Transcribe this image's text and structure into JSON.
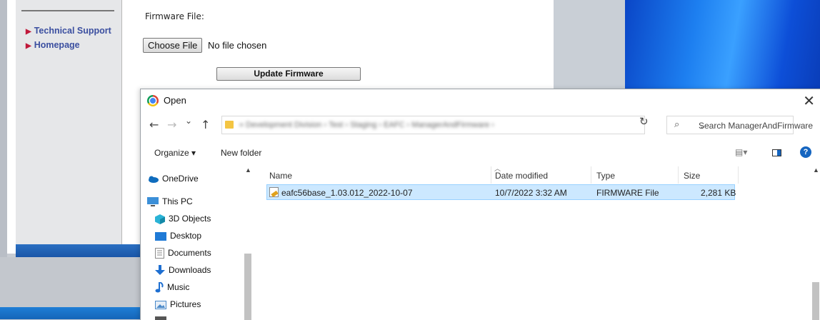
{
  "web": {
    "sidebar_links": [
      "Technical Support",
      "Homepage"
    ],
    "firmware_label": "Firmware File:",
    "choose_file_label": "Choose File",
    "no_file_text": "No file chosen",
    "update_button": "Update Firmware"
  },
  "dialog": {
    "title": "Open",
    "close_glyph": "✕",
    "nav_back": "←",
    "nav_forward": "→",
    "nav_recent": "⌄",
    "nav_up": "↑",
    "breadcrumb": "« Development Division › Test › Staging › EAFC › ManagerAndFirmware ›",
    "address_dropdown": "⌄",
    "refresh_glyph": "↻",
    "search_placeholder": "Search ManagerAndFirmware",
    "toolbar": {
      "organize": "Organize ▾",
      "new_folder": "New folder",
      "view_glyph": "▤▾",
      "help": "?"
    },
    "nav_items": [
      {
        "label": "OneDrive",
        "icon": "cloud-icon",
        "color": "#0f6cbd"
      },
      {
        "label": "This PC",
        "icon": "computer-icon",
        "color": "#3b8fd8"
      },
      {
        "label": "3D Objects",
        "icon": "cube-icon",
        "color": "#2ab3d6"
      },
      {
        "label": "Desktop",
        "icon": "desktop-icon",
        "color": "#1f7ad6"
      },
      {
        "label": "Documents",
        "icon": "document-icon",
        "color": "#8a8a8a"
      },
      {
        "label": "Downloads",
        "icon": "download-icon",
        "color": "#1e6fd1"
      },
      {
        "label": "Music",
        "icon": "music-icon",
        "color": "#1e6fd1"
      },
      {
        "label": "Pictures",
        "icon": "picture-icon",
        "color": "#4a89c9"
      }
    ],
    "columns": [
      "Name",
      "Date modified",
      "Type",
      "Size"
    ],
    "files": [
      {
        "name": "eafc56base_1.03.012_2022-10-07",
        "date": "10/7/2022 3:32 AM",
        "type": "FIRMWARE File",
        "size": "2,281 KB",
        "selected": true
      }
    ]
  }
}
